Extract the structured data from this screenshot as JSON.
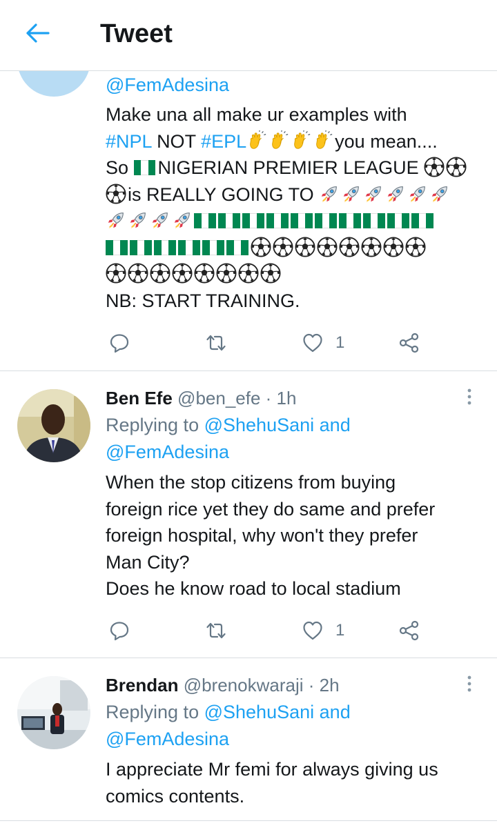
{
  "header": {
    "title": "Tweet"
  },
  "colors": {
    "accent": "#1da1f2",
    "muted": "#657786",
    "divider": "#d8dde1"
  },
  "tweets": [
    {
      "reply_mention": "@FemAdesina",
      "text_intro": "Make una all make ur examples with",
      "hashtag1": "#NPL",
      "word_not": "NOT",
      "hashtag2": "#EPL",
      "you_mean": "you mean....",
      "so": "So",
      "nigerian": "NIGERIAN PREMIER LEAGUE",
      "really": "is REALLY GOING TO",
      "nb": "NB: START TRAINING.",
      "like_count": "1"
    },
    {
      "name": "Ben Efe",
      "handle": "@ben_efe",
      "time": "· 1h",
      "replying_label": "Replying to",
      "mention1": "@ShehuSani",
      "and": "and",
      "mention2": "@FemAdesina",
      "text_lines": [
        "When the stop citizens from buying",
        "foreign rice yet they do same and prefer",
        "foreign hospital, why won't they prefer",
        "Man City?",
        "Does he know road to local stadium"
      ],
      "like_count": "1"
    },
    {
      "name": "Brendan",
      "handle": "@brenokwaraji",
      "time": "· 2h",
      "replying_label": "Replying to",
      "mention1": "@ShehuSani",
      "and": "and",
      "mention2": "@FemAdesina",
      "text_lines": [
        "I appreciate Mr femi for always giving us",
        "comics contents."
      ]
    }
  ],
  "icons": {
    "back": "arrow-left-icon",
    "reply": "comment-icon",
    "retweet": "retweet-icon",
    "like": "heart-icon",
    "share": "share-icon",
    "more": "more-vertical-icon",
    "clap": "clapping-hands-emoji",
    "soccer": "soccer-ball-emoji",
    "rocket": "rocket-emoji",
    "flag": "nigeria-flag-emoji"
  }
}
